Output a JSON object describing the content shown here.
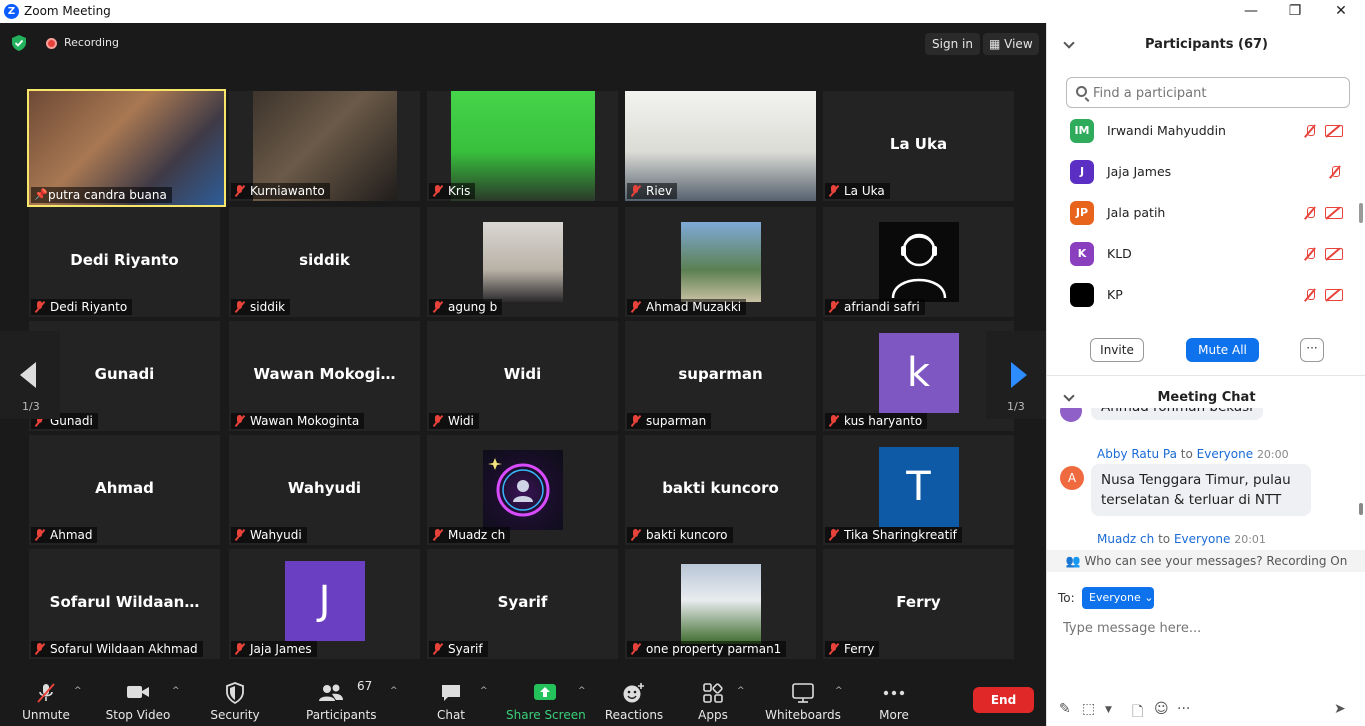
{
  "window": {
    "title": "Zoom Meeting",
    "logo_letter": "Z",
    "min": "—",
    "max": "❐",
    "close": "✕"
  },
  "topbar": {
    "recording_label": "Recording",
    "sign_in": "Sign in",
    "view": "View"
  },
  "grid": {
    "page_indicator": "1/3",
    "tiles": [
      {
        "name": "putra candra buana",
        "type": "video",
        "active": true,
        "pinned": true
      },
      {
        "name": "Kurniawanto",
        "type": "video"
      },
      {
        "name": "Kris",
        "type": "video"
      },
      {
        "name": "Riev",
        "type": "video"
      },
      {
        "name": "La Uka",
        "type": "text",
        "display": "La Uka"
      },
      {
        "name": "Dedi Riyanto",
        "type": "text",
        "display": "Dedi Riyanto"
      },
      {
        "name": "siddik",
        "type": "text",
        "display": "siddik"
      },
      {
        "name": "agung b",
        "type": "photo"
      },
      {
        "name": "Ahmad Muzakki",
        "type": "photo"
      },
      {
        "name": "afriandi safri",
        "type": "photo"
      },
      {
        "name": "Gunadi",
        "type": "text",
        "display": "Gunadi"
      },
      {
        "name": "Wawan Mokoginta",
        "type": "text",
        "display": "Wawan  Mokogi…"
      },
      {
        "name": "Widi",
        "type": "text",
        "display": "Widi"
      },
      {
        "name": "suparman",
        "type": "text",
        "display": "suparman"
      },
      {
        "name": "kus haryanto",
        "type": "letter",
        "letter": "k",
        "color": "#7e57c2"
      },
      {
        "name": "Ahmad",
        "type": "text",
        "display": "Ahmad"
      },
      {
        "name": "Wahyudi",
        "type": "text",
        "display": "Wahyudi"
      },
      {
        "name": "Muadz ch",
        "type": "photo"
      },
      {
        "name": "bakti kuncoro",
        "type": "text",
        "display": "bakti kuncoro"
      },
      {
        "name": "Tika Sharingkreatif",
        "type": "letter",
        "letter": "T",
        "color": "#0e5aa7"
      },
      {
        "name": "Sofarul Wildaan Akhmad",
        "type": "text",
        "display": "Sofarul  Wildaan…"
      },
      {
        "name": "Jaja James",
        "type": "letter",
        "letter": "J",
        "color": "#6a3fc2"
      },
      {
        "name": "Syarif",
        "type": "text",
        "display": "Syarif"
      },
      {
        "name": "one property parman1",
        "type": "photo"
      },
      {
        "name": "Ferry",
        "type": "text",
        "display": "Ferry"
      }
    ]
  },
  "toolbar": {
    "unmute": "Unmute",
    "stop_video": "Stop Video",
    "security": "Security",
    "participants": "Participants",
    "participants_count": "67",
    "chat": "Chat",
    "share_screen": "Share Screen",
    "reactions": "Reactions",
    "apps": "Apps",
    "whiteboards": "Whiteboards",
    "more": "More",
    "end": "End"
  },
  "participants_panel": {
    "title": "Participants (67)",
    "search_placeholder": "Find a participant",
    "items": [
      {
        "initials": "IM",
        "name": "Irwandi Mahyuddin",
        "color": "#2eab5b",
        "camera_off": true
      },
      {
        "initials": "J",
        "name": "Jaja James",
        "color": "#5b2fc4",
        "camera_off": false
      },
      {
        "initials": "JP",
        "name": "Jala patih",
        "color": "#e8641c",
        "camera_off": true
      },
      {
        "initials": "K",
        "name": "KLD",
        "color": "#8a3fbf",
        "camera_off": true
      },
      {
        "initials": "",
        "name": "KP",
        "color": "#000000",
        "camera_off": true
      }
    ],
    "invite": "Invite",
    "mute_all": "Mute All",
    "more": "···"
  },
  "chat": {
    "title": "Meeting Chat",
    "partial_message": "Ahmad rohman bekasi",
    "messages": [
      {
        "sender": "Abby Ratu Pa",
        "to_word": "to",
        "recipient": "Everyone",
        "time": "20:00",
        "avatar": "A",
        "avatar_color": "#f06a3f",
        "text": "Nusa Tenggara Timur, pulau terselatan & terluar di NTT"
      },
      {
        "sender": "Muadz ch",
        "to_word": "to",
        "recipient": "Everyone",
        "time": "20:01"
      }
    ],
    "notice": "Who can see your messages? Recording On",
    "to_label": "To:",
    "to_value": "Everyone",
    "input_placeholder": "Type message here..."
  }
}
